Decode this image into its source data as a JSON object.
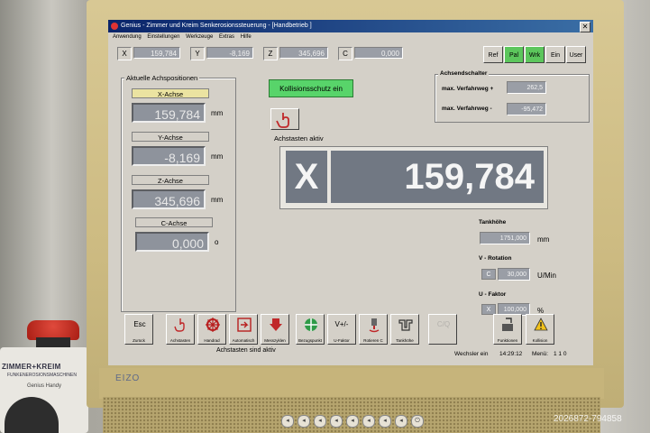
{
  "window": {
    "title": "Genius - Zimmer und Kreim Senkerosionssteuerung - [Handbetrieb ]",
    "close_glyph": "✕"
  },
  "menu": [
    "Anwendung",
    "Einstellungen",
    "Werkzeuge",
    "Extras",
    "Hilfe"
  ],
  "position_bar": [
    {
      "axis": "X",
      "value": "159,784"
    },
    {
      "axis": "Y",
      "value": "-8,169"
    },
    {
      "axis": "Z",
      "value": "345,696"
    },
    {
      "axis": "C",
      "value": "0,000"
    }
  ],
  "mode_buttons": [
    {
      "label": "Ref",
      "active": false
    },
    {
      "label": "Pal",
      "active": true
    },
    {
      "label": "Wrk",
      "active": true
    },
    {
      "label": "Ein",
      "active": false
    },
    {
      "label": "User",
      "active": false
    }
  ],
  "actual_positions": {
    "title": "Aktuelle Achspositionen",
    "axes": [
      {
        "name": "X-Achse",
        "value": "159,784",
        "unit": "mm",
        "selected": true
      },
      {
        "name": "Y-Achse",
        "value": "-8,169",
        "unit": "mm",
        "selected": false
      },
      {
        "name": "Z-Achse",
        "value": "345,696",
        "unit": "mm",
        "selected": false
      },
      {
        "name": "C-Achse",
        "value": "0,000",
        "unit": "o",
        "selected": false
      }
    ]
  },
  "collision": {
    "label": "Kollisionsschutz ein",
    "color": "#58d46a"
  },
  "active_axis": {
    "title": "Achstasten aktiv",
    "axis": "X",
    "value": "159,784"
  },
  "limit_switch": {
    "title": "Achsendschalter",
    "rows": [
      {
        "label": "max. Verfahrweg +",
        "value": "262,5"
      },
      {
        "label": "max. Verfahrweg -",
        "value": "-95,472"
      }
    ]
  },
  "tank": {
    "label": "Tankhöhe",
    "value": "1751,000",
    "unit": "mm"
  },
  "v_rotation": {
    "label": "V - Rotation",
    "prefix": "C",
    "value": "30,000",
    "unit": "U/Min"
  },
  "u_factor": {
    "label": "U - Faktor",
    "prefix": "X",
    "value": "100,000",
    "unit": "%"
  },
  "function_keys": [
    {
      "label": "Zurück",
      "icon": "esc-icon",
      "glyph": "Esc"
    },
    {
      "label": "Achstasten",
      "icon": "hand-icon"
    },
    {
      "label": "Handrad",
      "icon": "handwheel-icon"
    },
    {
      "label": "Automatisch",
      "icon": "auto-icon"
    },
    {
      "label": "Messzyklen",
      "icon": "measure-icon"
    },
    {
      "label": "Bezugspunkt",
      "icon": "reference-point-icon"
    },
    {
      "label": "U-Faktor",
      "icon": "u-factor-icon",
      "glyph": "V+/-"
    },
    {
      "label": "Rotieren C",
      "icon": "rotate-icon"
    },
    {
      "label": "Tankhöhe",
      "icon": "tank-icon"
    },
    {
      "label": "",
      "icon": "calc-icon",
      "glyph": "C/Q"
    },
    {
      "label": "Funktionen",
      "icon": "functions-icon"
    },
    {
      "label": "Kollision",
      "icon": "collision-icon"
    }
  ],
  "status": {
    "message": "Achstasten sind aktiv",
    "wechsler_label": "Wechsler ein",
    "time": "14:29:12",
    "menu_label": "Menü:",
    "menu_value": "1 1 0"
  },
  "monitor": {
    "brand": "EIZO"
  },
  "pendant": {
    "brand": "ZIMMER+KREIM",
    "sub": "FUNKENEROSIONSMASCHINEN",
    "handy": "Genius Handy"
  },
  "watermark": "2026872-794858",
  "colors": {
    "active_green": "#5cc65c",
    "title_blue": "#0a246a",
    "value_grey": "#717883"
  }
}
